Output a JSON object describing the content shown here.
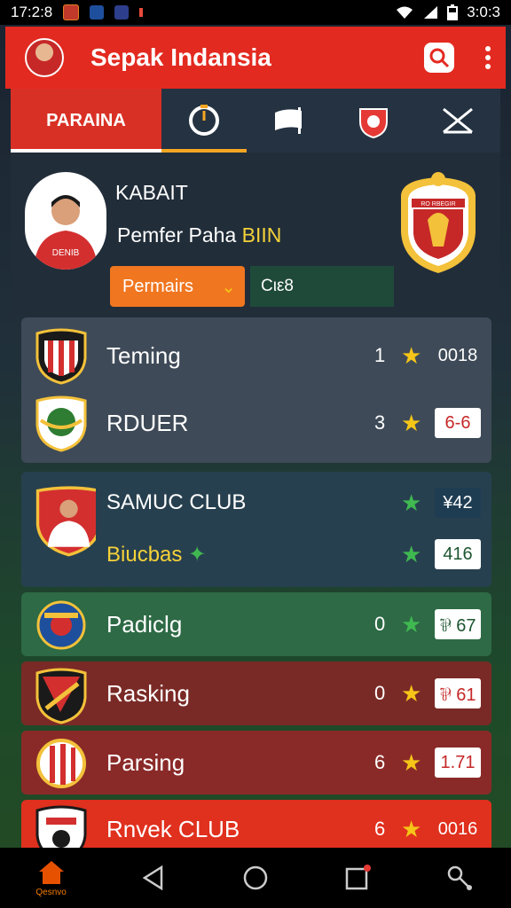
{
  "status_bar": {
    "time": "17:2:8",
    "battery_text": "3:0:3"
  },
  "app_bar": {
    "title": "Sepak Indansia"
  },
  "tabs": [
    {
      "label": "PARAINA",
      "icon": "team-label"
    },
    {
      "label": "",
      "icon": "timer-icon"
    },
    {
      "label": "",
      "icon": "flag-icon"
    },
    {
      "label": "",
      "icon": "shield-icon"
    },
    {
      "label": "",
      "icon": "stats-icon"
    }
  ],
  "profile": {
    "name": "KABAIT",
    "subtitle_main": "Pemfer Paha",
    "subtitle_highlight": "BIIN",
    "jersey_text": "DENIB",
    "dropdown_label": "Permairs",
    "code_label": "Cιε8",
    "club_crest_text": "RO RBEGIR"
  },
  "clubs": [
    {
      "name": "Teming",
      "number": "1",
      "score": "0018",
      "score_style": "plain"
    },
    {
      "name": "RDUER",
      "number": "3",
      "score": "6-6",
      "score_style": "box"
    },
    {
      "name": "SAMUC CLUB",
      "number": "",
      "score": "¥42",
      "score_style": "plain"
    },
    {
      "name": "Biucbas",
      "number": "",
      "score": "416",
      "score_style": "box"
    },
    {
      "name": "Padiclg",
      "number": "0",
      "score": "⅌ 67",
      "score_style": "box"
    },
    {
      "name": "Rasking",
      "number": "0",
      "score": "⅌ 61",
      "score_style": "box"
    },
    {
      "name": "Parsing",
      "number": "6",
      "score": "1.71",
      "score_style": "box"
    },
    {
      "name": "Rnvek CLUB",
      "number": "6",
      "score": "0016",
      "score_style": "plain"
    }
  ],
  "bottom_nav": {
    "home_label": "Qesnvo"
  },
  "colors": {
    "brand_red": "#e32a20",
    "tab_bar": "#243241",
    "accent_orange": "#f07620",
    "star_yellow": "#f5c518",
    "star_green": "#3fb950"
  }
}
